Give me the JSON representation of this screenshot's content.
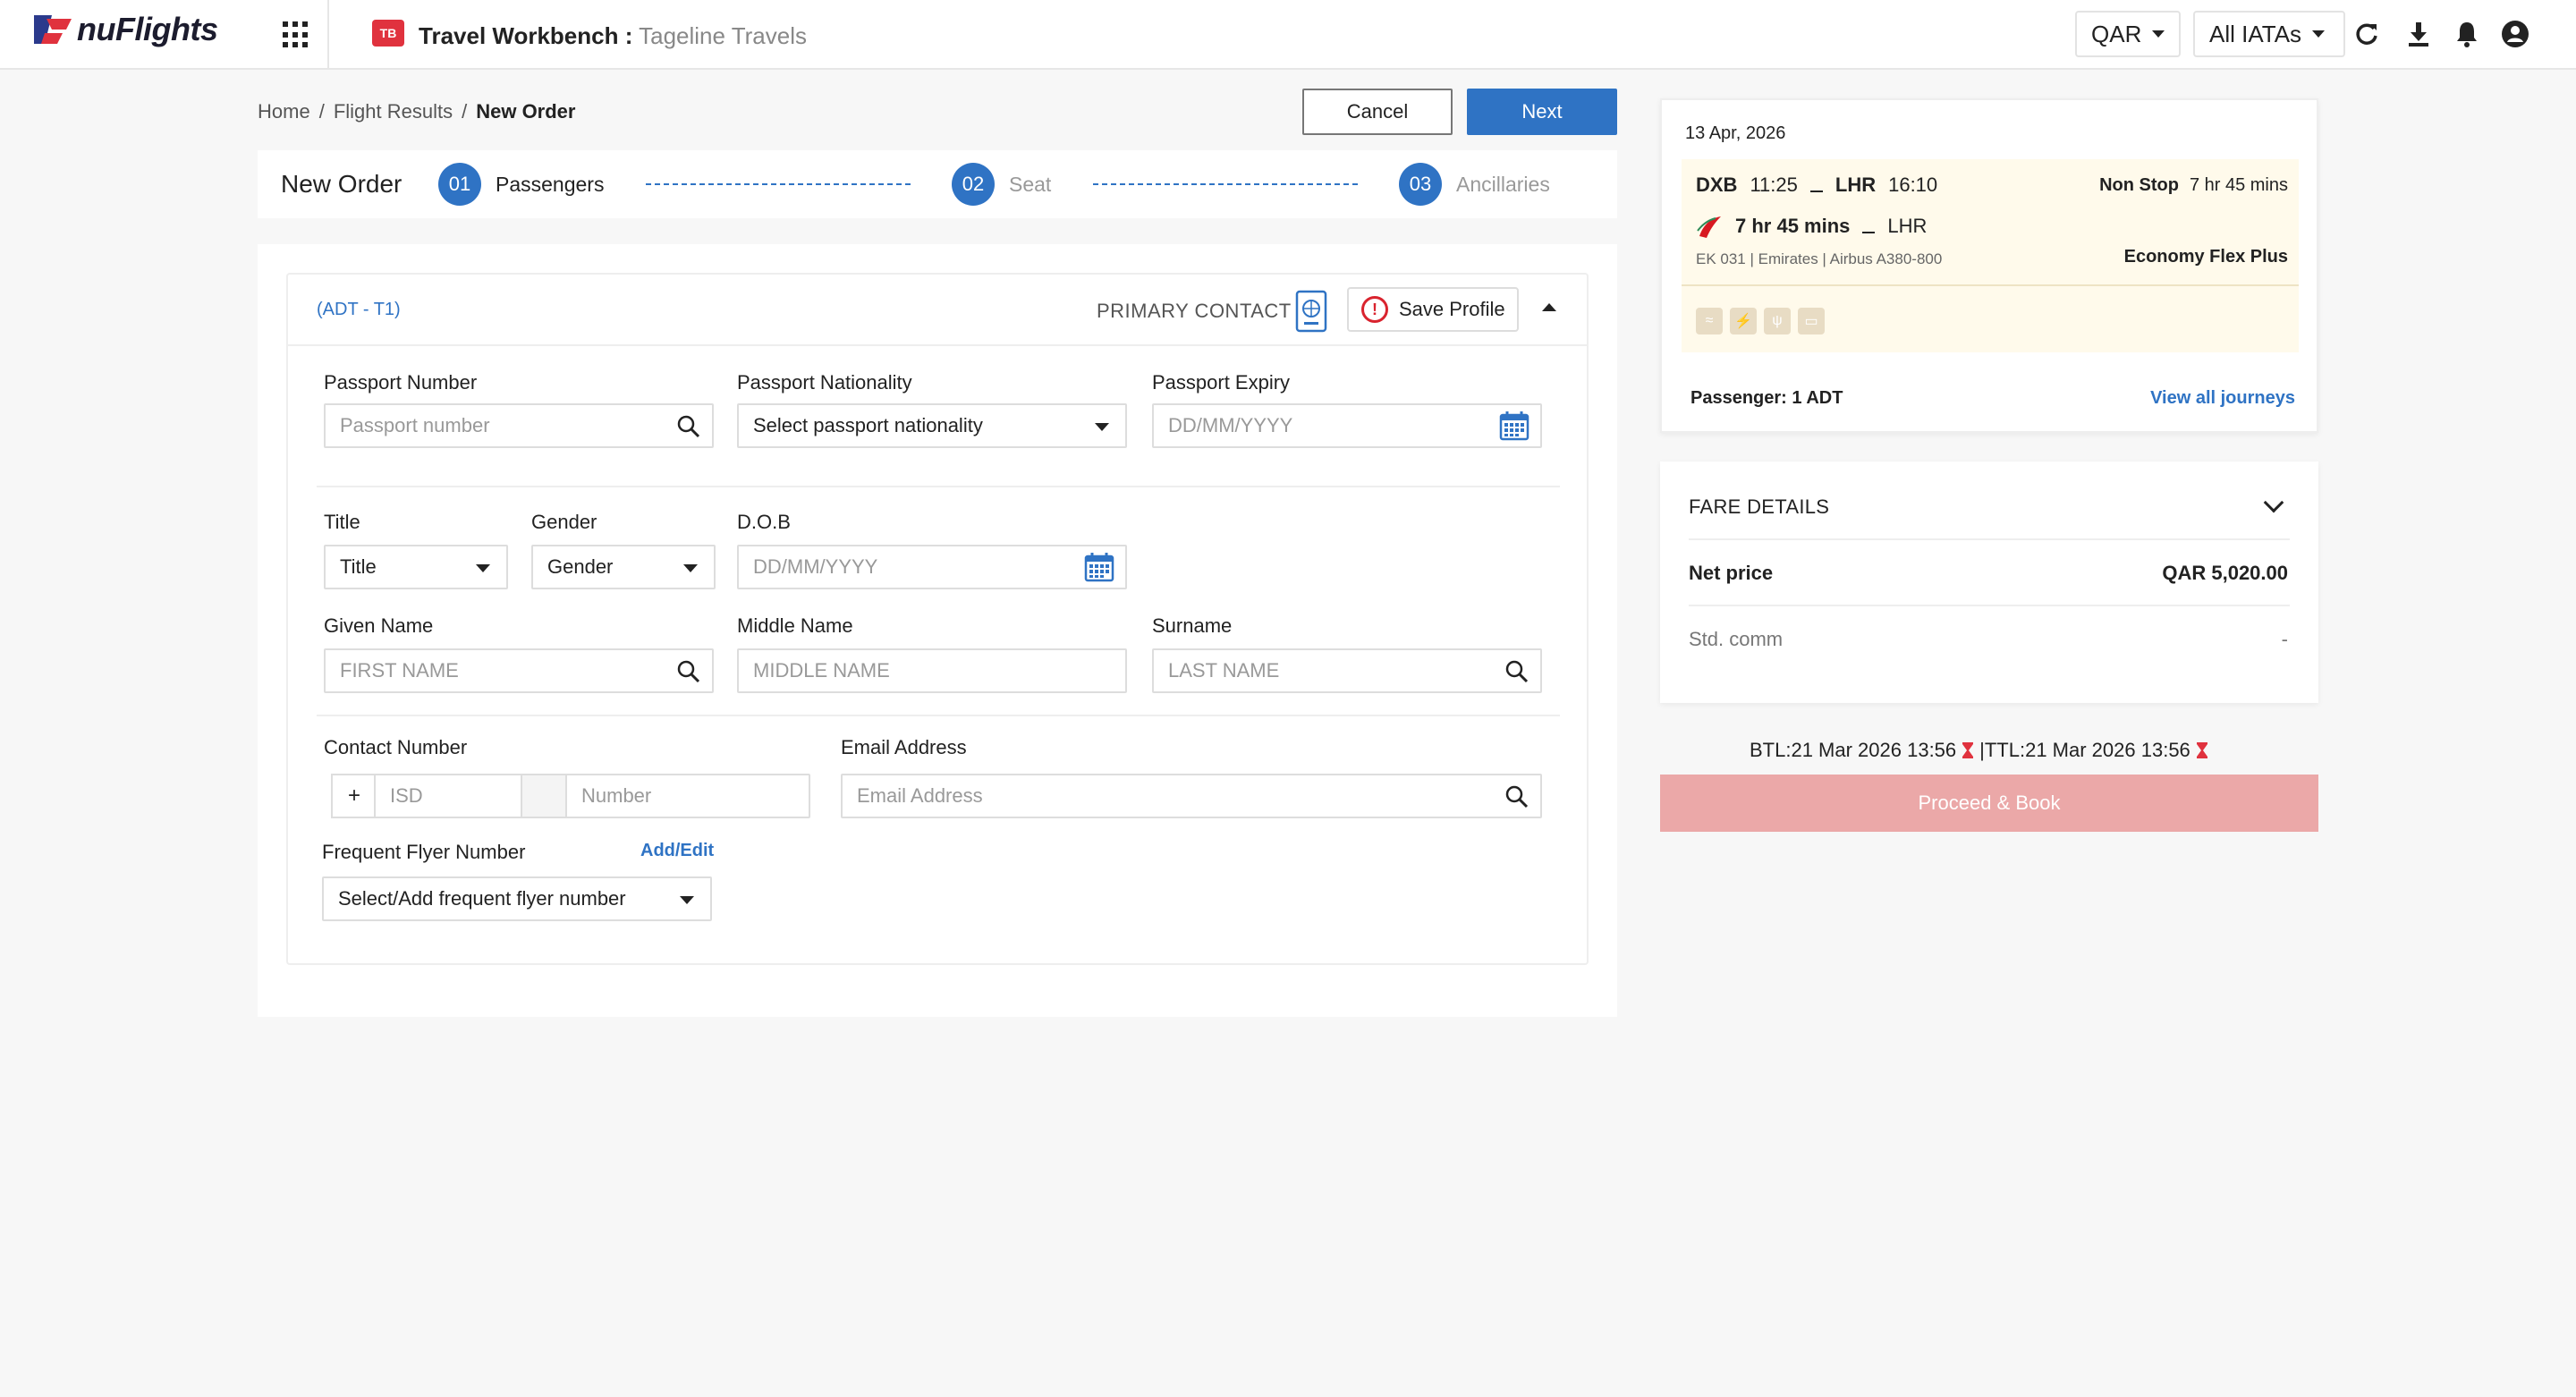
{
  "header": {
    "logo_text": "nuFlights",
    "app_badge": "TB",
    "app_title": "Travel Workbench :",
    "app_subtitle": " Tageline Travels",
    "currency": "QAR",
    "iata": "All IATAs",
    "icons": [
      "apps-grid-icon",
      "refresh-icon",
      "download-icon",
      "bell-icon",
      "user-account-icon"
    ]
  },
  "breadcrumb": {
    "home": "Home",
    "results": "Flight Results",
    "current": "New Order",
    "sep": "/"
  },
  "actions": {
    "cancel": "Cancel",
    "next": "Next"
  },
  "stepper": {
    "title": "New Order",
    "steps": [
      {
        "num": "01",
        "label": "Passengers",
        "active": true
      },
      {
        "num": "02",
        "label": "Seat",
        "active": false
      },
      {
        "num": "03",
        "label": "Ancillaries",
        "active": false
      }
    ]
  },
  "passenger": {
    "tag": "(ADT - T1)",
    "primary_contact": "PRIMARY CONTACT",
    "save_profile": "Save Profile",
    "passport_number": {
      "label": "Passport Number",
      "placeholder": "Passport number"
    },
    "passport_nationality": {
      "label": "Passport Nationality",
      "value": "Select passport nationality"
    },
    "passport_expiry": {
      "label": "Passport Expiry",
      "placeholder": "DD/MM/YYYY"
    },
    "title": {
      "label": "Title",
      "value": "Title"
    },
    "gender": {
      "label": "Gender",
      "value": "Gender"
    },
    "dob": {
      "label": "D.O.B",
      "placeholder": "DD/MM/YYYY"
    },
    "given_name": {
      "label": "Given Name",
      "placeholder": "FIRST NAME"
    },
    "middle_name": {
      "label": "Middle Name",
      "placeholder": "MIDDLE NAME"
    },
    "surname": {
      "label": "Surname",
      "placeholder": "LAST NAME"
    },
    "contact": {
      "label": "Contact Number",
      "plus": "+",
      "isd_placeholder": "ISD",
      "number_placeholder": "Number"
    },
    "email": {
      "label": "Email Address",
      "placeholder": "Email Address"
    },
    "ffn": {
      "label": "Frequent Flyer Number",
      "add_edit": "Add/Edit",
      "value": "Select/Add frequent flyer number"
    }
  },
  "journey": {
    "date": "13 Apr, 2026",
    "from": "DXB",
    "dep_time": "11:25",
    "to": "LHR",
    "arr_time": "16:10",
    "stops": "Non Stop",
    "duration": "7 hr 45 mins",
    "duration_bold": "7 hr 45 mins",
    "to_short": "LHR",
    "meta": "EK 031 | Emirates | Airbus A380-800",
    "fare_class": "Economy Flex Plus",
    "passenger": "Passenger: 1 ADT",
    "view_all": "View all journeys",
    "amenities": [
      "wifi-icon",
      "power-icon",
      "meal-icon",
      "entertainment-icon"
    ]
  },
  "fare": {
    "title": "FARE DETAILS",
    "net_label": "Net price",
    "net_value": "QAR 5,020.00",
    "comm_label": "Std. comm",
    "comm_value": "-"
  },
  "deadline": {
    "btl": "BTL:21 Mar 2026 13:56",
    "ttl": "|TTL:21 Mar 2026 13:56"
  },
  "proceed": "Proceed & Book",
  "colors": {
    "primary": "#2f73c4",
    "danger": "#d9232e",
    "proceed_disabled": "#eba8a8",
    "flight_bg": "#fffaeb"
  }
}
